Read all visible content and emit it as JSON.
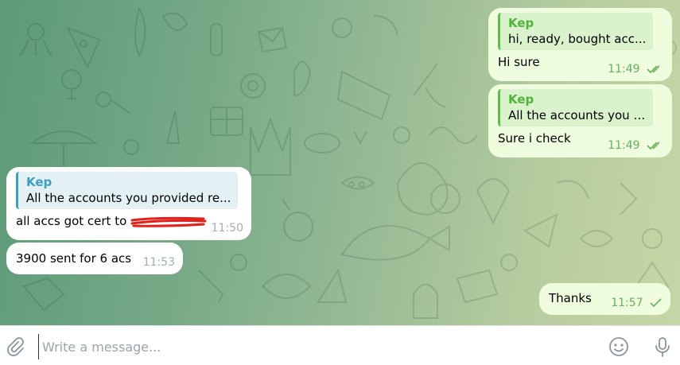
{
  "chat": {
    "messages": [
      {
        "direction": "outgoing",
        "reply_author": "Kep",
        "reply_text": "hi,  ready, bought acc...",
        "text": "Hi sure",
        "time": "11:49",
        "status": "read"
      },
      {
        "direction": "outgoing",
        "reply_author": "Kep",
        "reply_text": "All the accounts you p...",
        "text": "Sure i check",
        "time": "11:49",
        "status": "read"
      },
      {
        "direction": "incoming",
        "reply_author": "Kep",
        "reply_text": "All the accounts you provided re...",
        "text": "all accs got cert to",
        "redacted": true,
        "time": "11:50"
      },
      {
        "direction": "incoming",
        "text": "3900 sent for 6 acs",
        "time": "11:53"
      },
      {
        "direction": "outgoing",
        "text": "Thanks",
        "time": "11:57",
        "status": "sent"
      }
    ]
  },
  "composer": {
    "placeholder": "Write a message...",
    "value": "",
    "icons": [
      "paperclip-icon",
      "emoji-icon",
      "microphone-icon"
    ]
  },
  "colors": {
    "outgoing_bubble": "#effdde",
    "incoming_bubble": "#ffffff",
    "outgoing_accent": "#4db33b",
    "incoming_accent": "#3a9fbf",
    "redaction": "#e3201b"
  }
}
